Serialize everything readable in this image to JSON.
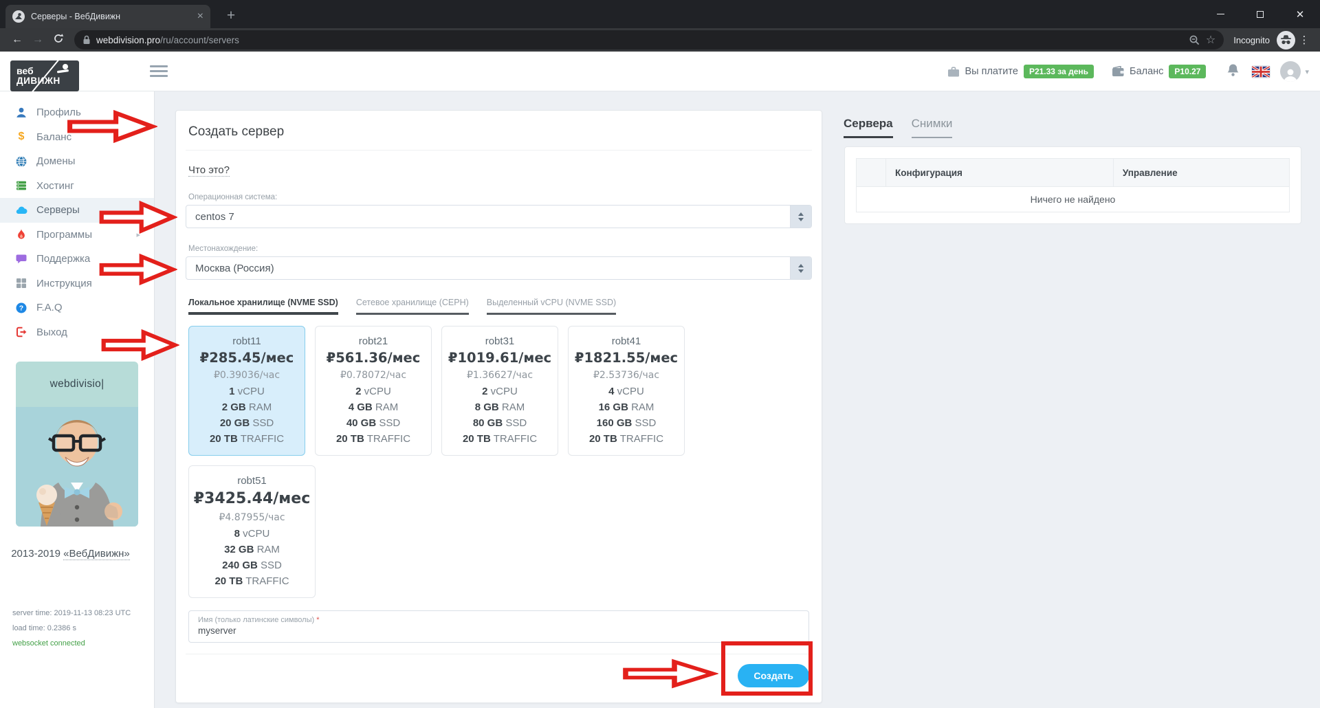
{
  "colors": {
    "page_bg": "#edf0f4",
    "accent_blue": "#29b2f3",
    "badge_green": "#5cb85c",
    "annotation_red": "#e3201b",
    "selected_plan_bg": "#d8eefb",
    "selected_plan_border": "#86cdec"
  },
  "browser": {
    "tab_title": "Серверы - ВебДивижн",
    "url_host": "webdivision.pro",
    "url_path": "/ru/account/servers",
    "incognito_label": "Incognito"
  },
  "header": {
    "logo_line1": "веб",
    "logo_line2": "ДИВИЖН",
    "pay_label": "Вы платите",
    "pay_badge": "Р21.33 за день",
    "balance_label": "Баланс",
    "balance_badge": "Р10.27"
  },
  "sidebar": {
    "items": [
      {
        "label": "Профиль",
        "icon": "user-icon",
        "active": false,
        "submenu": false
      },
      {
        "label": "Баланс",
        "icon": "dollar-icon",
        "active": false,
        "submenu": false
      },
      {
        "label": "Домены",
        "icon": "globe-icon",
        "active": false,
        "submenu": false
      },
      {
        "label": "Хостинг",
        "icon": "hosting-icon",
        "active": false,
        "submenu": false
      },
      {
        "label": "Серверы",
        "icon": "cloud-icon",
        "active": true,
        "submenu": false
      },
      {
        "label": "Программы",
        "icon": "flame-icon",
        "active": false,
        "submenu": true
      },
      {
        "label": "Поддержка",
        "icon": "chat-icon",
        "active": false,
        "submenu": false
      },
      {
        "label": "Инструкция",
        "icon": "grid-icon",
        "active": false,
        "submenu": false
      },
      {
        "label": "F.A.Q",
        "icon": "question-icon",
        "active": false,
        "submenu": false
      },
      {
        "label": "Выход",
        "icon": "logout-icon",
        "active": false,
        "submenu": false
      }
    ],
    "promo_text": "webdivisio|",
    "copyright_prefix": "2013-2019 ",
    "copyright_link": "«ВебДивижн»",
    "server_time": "server time: 2019-11-13 08:23 UTC",
    "load_time": "load time: 0.2386 s",
    "websocket": "websocket connected"
  },
  "main": {
    "title": "Создать сервер",
    "what_link": "Что это?",
    "os_label": "Операционная система:",
    "os_value": "centos 7",
    "location_label": "Местонахождение:",
    "location_value": "Москва (Россия)",
    "storage_tabs": [
      {
        "label": "Локальное хранилище (NVME SSD)",
        "active": true
      },
      {
        "label": "Сетевое хранилище (CEPH)",
        "active": false
      },
      {
        "label": "Выделенный vCPU (NVME SSD)",
        "active": false
      }
    ],
    "plans": [
      {
        "name": "robt11",
        "monthly": "₽285.45/мес",
        "hourly": "₽0.39036/час",
        "selected": true,
        "big": false,
        "specs": [
          [
            "1",
            " vCPU"
          ],
          [
            "2 GB",
            " RAM"
          ],
          [
            "20 GB",
            " SSD"
          ],
          [
            "20 TB",
            " TRAFFIC"
          ]
        ]
      },
      {
        "name": "robt21",
        "monthly": "₽561.36/мес",
        "hourly": "₽0.78072/час",
        "selected": false,
        "big": false,
        "specs": [
          [
            "2",
            " vCPU"
          ],
          [
            "4 GB",
            " RAM"
          ],
          [
            "40 GB",
            " SSD"
          ],
          [
            "20 TB",
            " TRAFFIC"
          ]
        ]
      },
      {
        "name": "robt31",
        "monthly": "₽1019.61/мес",
        "hourly": "₽1.36627/час",
        "selected": false,
        "big": false,
        "specs": [
          [
            "2",
            " vCPU"
          ],
          [
            "8 GB",
            " RAM"
          ],
          [
            "80 GB",
            " SSD"
          ],
          [
            "20 TB",
            " TRAFFIC"
          ]
        ]
      },
      {
        "name": "robt41",
        "monthly": "₽1821.55/мес",
        "hourly": "₽2.53736/час",
        "selected": false,
        "big": false,
        "specs": [
          [
            "4",
            " vCPU"
          ],
          [
            "16 GB",
            " RAM"
          ],
          [
            "160 GB",
            " SSD"
          ],
          [
            "20 TB",
            " TRAFFIC"
          ]
        ]
      },
      {
        "name": "robt51",
        "monthly": "₽3425.44/мес",
        "hourly": "₽4.87955/час",
        "selected": false,
        "big": true,
        "specs": [
          [
            "8",
            " vCPU"
          ],
          [
            "32 GB",
            " RAM"
          ],
          [
            "240 GB",
            " SSD"
          ],
          [
            "20 TB",
            " TRAFFIC"
          ]
        ]
      }
    ],
    "name_label": "Имя (только латинские символы) ",
    "name_required": "*",
    "name_value": "myserver",
    "create_button": "Создать"
  },
  "panel": {
    "tabs": [
      {
        "label": "Сервера",
        "active": true
      },
      {
        "label": "Снимки",
        "active": false
      }
    ],
    "table": {
      "headers": [
        "",
        "Конфигурация",
        "Управление"
      ],
      "empty_text": "Ничего не найдено"
    }
  }
}
